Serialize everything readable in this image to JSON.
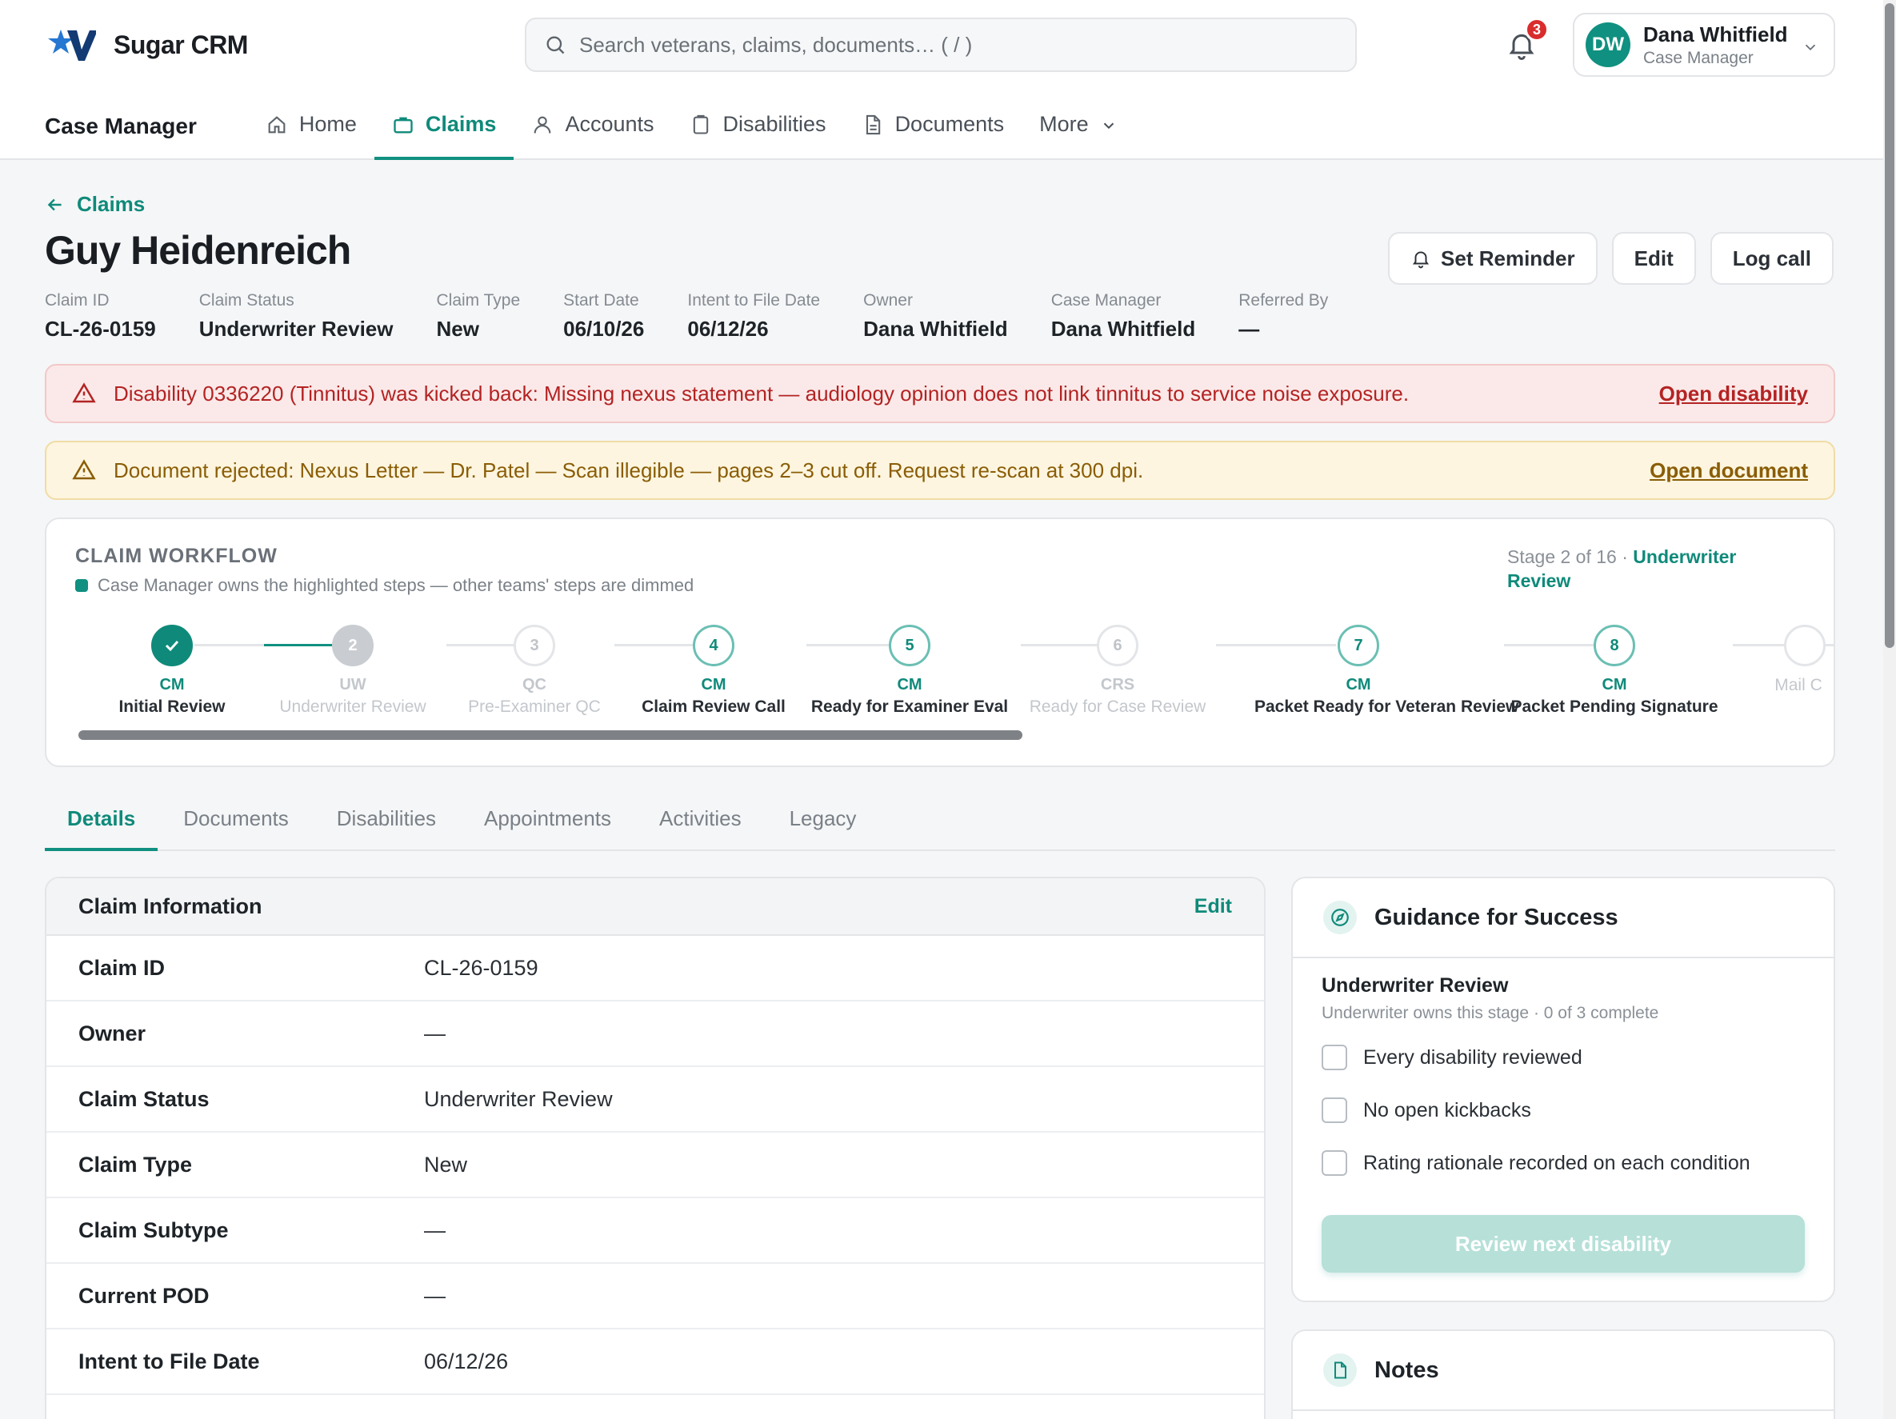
{
  "app": {
    "name": "Sugar CRM"
  },
  "search": {
    "placeholder": "Search veterans, claims, documents…  ( / )"
  },
  "notifications": {
    "count": "3"
  },
  "user": {
    "initials": "DW",
    "name": "Dana Whitfield",
    "role": "Case Manager"
  },
  "nav": {
    "title": "Case Manager",
    "items": [
      {
        "label": "Home",
        "icon": "home-icon"
      },
      {
        "label": "Claims",
        "icon": "briefcase-icon",
        "active": true
      },
      {
        "label": "Accounts",
        "icon": "user-icon"
      },
      {
        "label": "Disabilities",
        "icon": "clipboard-icon"
      },
      {
        "label": "Documents",
        "icon": "document-icon"
      },
      {
        "label": "More",
        "icon": "chevron-down-icon"
      }
    ]
  },
  "breadcrumb": {
    "back_label": "Claims"
  },
  "record": {
    "title": "Guy Heidenreich",
    "actions": {
      "reminder": "Set Reminder",
      "edit": "Edit",
      "log_call": "Log call"
    },
    "meta": [
      {
        "label": "Claim ID",
        "value": "CL-26-0159"
      },
      {
        "label": "Claim Status",
        "value": "Underwriter Review"
      },
      {
        "label": "Claim Type",
        "value": "New"
      },
      {
        "label": "Start Date",
        "value": "06/10/26"
      },
      {
        "label": "Intent to File Date",
        "value": "06/12/26"
      },
      {
        "label": "Owner",
        "value": "Dana Whitfield"
      },
      {
        "label": "Case Manager",
        "value": "Dana Whitfield"
      },
      {
        "label": "Referred By",
        "value": "—"
      }
    ]
  },
  "alerts": {
    "kickback": {
      "message": "Disability 0336220 (Tinnitus) was kicked back: Missing nexus statement — audiology opinion does not link tinnitus to service noise exposure.",
      "link": "Open disability",
      "color": "#b42323"
    },
    "rejected": {
      "message": "Document rejected: Nexus Letter — Dr. Patel — Scan illegible — pages 2–3 cut off. Request re-scan at 300 dpi.",
      "link": "Open document",
      "color": "#8a5d06"
    }
  },
  "workflow": {
    "title": "CLAIM WORKFLOW",
    "legend": "Case Manager owns the highlighted steps — other teams' steps are dimmed",
    "stage_prefix": "Stage 2 of 16 · ",
    "stage_name": "Underwriter Review",
    "steps": [
      {
        "num": "",
        "team": "CM",
        "name": "Initial Review",
        "state": "done"
      },
      {
        "num": "2",
        "team": "UW",
        "name": "Underwriter Review",
        "state": "current"
      },
      {
        "num": "3",
        "team": "QC",
        "name": "Pre-Examiner QC",
        "state": "dim"
      },
      {
        "num": "4",
        "team": "CM",
        "name": "Claim Review Call",
        "state": "own"
      },
      {
        "num": "5",
        "team": "CM",
        "name": "Ready for Examiner Eval",
        "state": "own"
      },
      {
        "num": "6",
        "team": "CRS",
        "name": "Ready for Case Review",
        "state": "dim"
      },
      {
        "num": "7",
        "team": "CM",
        "name": "Packet Ready for Veteran Review",
        "state": "own"
      },
      {
        "num": "8",
        "team": "CM",
        "name": "Packet Pending Signature",
        "state": "own"
      },
      {
        "num": "",
        "team": "",
        "name": "Mail C",
        "state": "dim"
      }
    ]
  },
  "tabs": [
    "Details",
    "Documents",
    "Disabilities",
    "Appointments",
    "Activities",
    "Legacy"
  ],
  "claim_info": {
    "title": "Claim Information",
    "edit": "Edit",
    "rows": [
      {
        "label": "Claim ID",
        "value": "CL-26-0159"
      },
      {
        "label": "Owner",
        "value": "—"
      },
      {
        "label": "Claim Status",
        "value": "Underwriter Review"
      },
      {
        "label": "Claim Type",
        "value": "New"
      },
      {
        "label": "Claim Subtype",
        "value": "—"
      },
      {
        "label": "Current POD",
        "value": "—"
      },
      {
        "label": "Intent to File Date",
        "value": "06/12/26"
      }
    ]
  },
  "guidance": {
    "title": "Guidance for Success",
    "stage": "Underwriter Review",
    "sub": "Underwriter owns this stage · 0 of 3 complete",
    "checks": [
      "Every disability reviewed",
      "No open kickbacks",
      "Rating rationale recorded on each condition"
    ],
    "button": "Review next disability"
  },
  "notes": {
    "title": "Notes"
  },
  "colors": {
    "accent": "#109080",
    "danger": "#d92d2d",
    "warning": "#8a5d06"
  }
}
